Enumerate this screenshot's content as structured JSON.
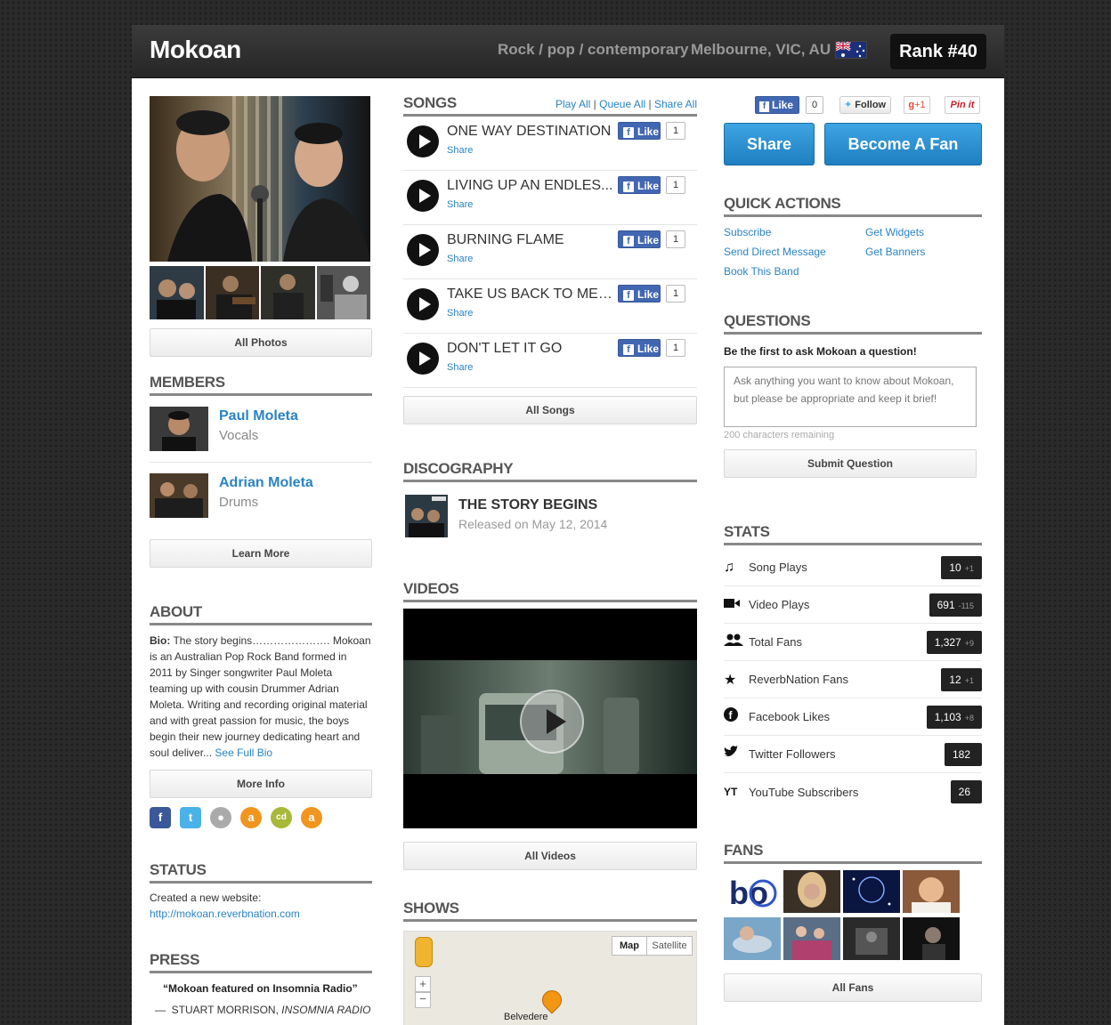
{
  "header": {
    "band_name": "Mokoan",
    "genre": "Rock / pop / contemporary",
    "location": "Melbourne, VIC, AU",
    "rank": "Rank #40"
  },
  "photos": {
    "all_label": "All Photos"
  },
  "members": {
    "title": "MEMBERS",
    "items": [
      {
        "name": "Paul Moleta",
        "role": "Vocals"
      },
      {
        "name": "Adrian Moleta",
        "role": "Drums"
      }
    ],
    "learn_more": "Learn More"
  },
  "about": {
    "title": "ABOUT",
    "bio_label": "Bio:",
    "bio_text": "The story begins…………………. Mokoan is an Australian Pop Rock Band formed in 2011 by Singer songwriter Paul Moleta teaming up with cousin Drummer Adrian Moleta. Writing and recording original material and with great passion for music, the boys begin their new journey dedicating heart and soul deliver...",
    "see_full_bio": "See Full Bio",
    "more_info": "More Info"
  },
  "status": {
    "title": "STATUS",
    "text": "Created a new website:",
    "link": "http://mokoan.reverbnation.com"
  },
  "press": {
    "title": "PRESS",
    "quote": "“Mokoan featured on Insomnia Radio”",
    "dash": "—",
    "author": "STUART MORRISON,",
    "source": "INSOMNIA RADIO"
  },
  "songs": {
    "title": "SONGS",
    "play_all": "Play All",
    "queue_all": "Queue All",
    "share_all": "Share All",
    "sep": "|",
    "share_label": "Share",
    "like_label": "Like",
    "items": [
      {
        "title": "ONE WAY DESTINATION",
        "likes": "1"
      },
      {
        "title": "LIVING UP AN ENDLES...",
        "likes": "1"
      },
      {
        "title": "BURNING FLAME",
        "likes": "1"
      },
      {
        "title": "TAKE US BACK TO MEM...",
        "likes": "1"
      },
      {
        "title": "DON'T LET IT GO",
        "likes": "1"
      }
    ],
    "all_songs": "All Songs"
  },
  "discography": {
    "title": "DISCOGRAPHY",
    "album": "THE STORY BEGINS",
    "released": "Released on May 12, 2014"
  },
  "videos": {
    "title": "VIDEOS",
    "all_videos": "All Videos"
  },
  "shows": {
    "title": "SHOWS",
    "map_btn": "Map",
    "satellite_btn": "Satellite",
    "zoom_in": "+",
    "zoom_out": "−",
    "place": "Belvedere"
  },
  "social_bar": {
    "fb_like": "Like",
    "fb_count": "0",
    "twitter": "Follow",
    "gplus": "+1",
    "pinit": "Pin it"
  },
  "actions": {
    "share": "Share",
    "become_fan": "Become A Fan"
  },
  "quick_actions": {
    "title": "QUICK ACTIONS",
    "subscribe": "Subscribe",
    "send_message": "Send Direct Message",
    "book": "Book This Band",
    "widgets": "Get Widgets",
    "banners": "Get Banners"
  },
  "questions": {
    "title": "QUESTIONS",
    "prompt": "Be the first to ask Mokoan a question!",
    "placeholder": "Ask anything you want to know about Mokoan, but please be appropriate and keep it brief!",
    "remaining": "200 characters remaining",
    "submit": "Submit Question"
  },
  "stats": {
    "title": "STATS",
    "items": [
      {
        "icon": "music-note-icon",
        "label": "Song Plays",
        "value": "10",
        "delta": "+1"
      },
      {
        "icon": "video-camera-icon",
        "label": "Video Plays",
        "value": "691",
        "delta": "-115"
      },
      {
        "icon": "people-icon",
        "label": "Total Fans",
        "value": "1,327",
        "delta": "+9"
      },
      {
        "icon": "star-icon",
        "label": "ReverbNation Fans",
        "value": "12",
        "delta": "+1"
      },
      {
        "icon": "facebook-icon",
        "label": "Facebook Likes",
        "value": "1,103",
        "delta": "+8"
      },
      {
        "icon": "twitter-icon",
        "label": "Twitter Followers",
        "value": "182",
        "delta": ""
      },
      {
        "icon": "youtube-icon",
        "label": "YouTube Subscribers",
        "value": "26",
        "delta": ""
      }
    ],
    "yt_glyph": "YT"
  },
  "fans": {
    "title": "FANS",
    "all_fans": "All Fans"
  },
  "colors": {
    "link": "#2a83c4",
    "accent_blue": "#2a8fd4",
    "fb_blue": "#4267b2"
  }
}
